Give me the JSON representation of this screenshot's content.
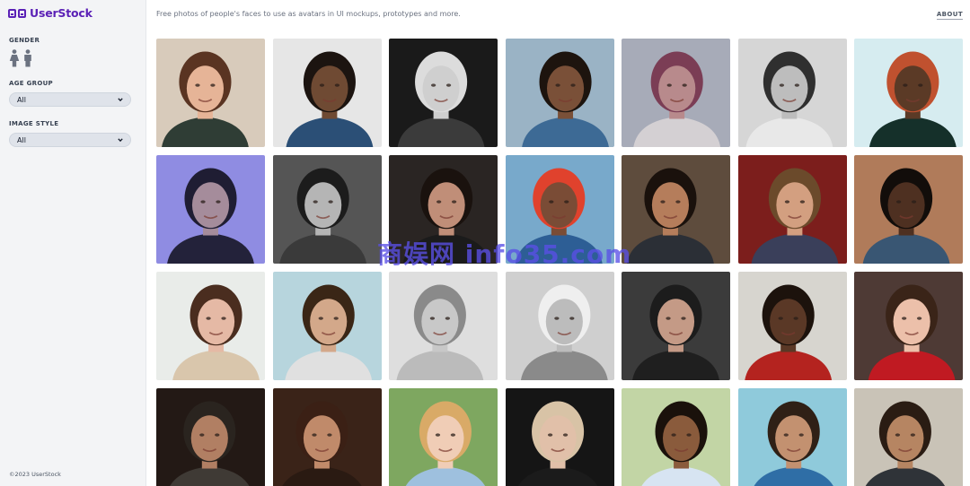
{
  "brand": {
    "name": "UserStock",
    "color": "#5b21b6"
  },
  "header": {
    "tagline": "Free photos of people's faces to use as avatars in UI mockups, prototypes and more.",
    "about_link": "ABOUT"
  },
  "sidebar": {
    "gender_label": "GENDER",
    "gender_icons": [
      "female-icon",
      "male-icon"
    ],
    "age_group_label": "AGE GROUP",
    "age_group_value": "All",
    "image_style_label": "IMAGE STYLE",
    "image_style_value": "All",
    "footer": "©2023 UserStock"
  },
  "watermark": "商娱网 info35.com",
  "photos": [
    {
      "bg": "#d8cbbb",
      "skin": "#e6b497",
      "hair": "#5a3422",
      "shirt": "#2f3d35"
    },
    {
      "bg": "#e6e6e6",
      "skin": "#6f4a33",
      "hair": "#1c1410",
      "shirt": "#2b4f76"
    },
    {
      "bg": "#1a1a1a",
      "skin": "#cfcfcf",
      "hair": "#dcdcdc",
      "shirt": "#3b3b3b"
    },
    {
      "bg": "#9ab3c5",
      "skin": "#7a5038",
      "hair": "#1d140e",
      "shirt": "#3d6a95"
    },
    {
      "bg": "#a7abb8",
      "skin": "#b88a8c",
      "hair": "#7b3d55",
      "shirt": "#d4d0d3"
    },
    {
      "bg": "#d6d6d6",
      "skin": "#bdbdbd",
      "hair": "#2f2f2f",
      "shirt": "#e8e8e8"
    },
    {
      "bg": "#d6ecf0",
      "skin": "#5b3a26",
      "hair": "#c0512f",
      "shirt": "#15302a"
    },
    {
      "bg": "#8f8ce2",
      "skin": "#a58c9b",
      "hair": "#1f1d33",
      "shirt": "#23223a"
    },
    {
      "bg": "#555555",
      "skin": "#b5b5b5",
      "hair": "#1c1c1c",
      "shirt": "#3a3a3a"
    },
    {
      "bg": "#2a2523",
      "skin": "#c08e78",
      "hair": "#1a120e",
      "shirt": "#1b1b1b"
    },
    {
      "bg": "#78a9cb",
      "skin": "#7a4c36",
      "hair": "#e0422d",
      "shirt": "#2d5e95"
    },
    {
      "bg": "#5e4c3d",
      "skin": "#b57d5b",
      "hair": "#1a110c",
      "shirt": "#2b2f36"
    },
    {
      "bg": "#7c1e1c",
      "skin": "#d39f80",
      "hair": "#6b4a2b",
      "shirt": "#3a3f5a"
    },
    {
      "bg": "#b07b5a",
      "skin": "#4e3021",
      "hair": "#120d0a",
      "shirt": "#395673"
    },
    {
      "bg": "#e9ece9",
      "skin": "#e5b9a5",
      "hair": "#4a2d1f",
      "shirt": "#d9c6ac"
    },
    {
      "bg": "#b7d5dd",
      "skin": "#d3a88a",
      "hair": "#3a2616",
      "shirt": "#e0e0e0"
    },
    {
      "bg": "#dedede",
      "skin": "#c8c8c8",
      "hair": "#8a8a8a",
      "shirt": "#bbbbbb"
    },
    {
      "bg": "#cfcfcf",
      "skin": "#bcbcbc",
      "hair": "#efefef",
      "shirt": "#8a8a8a"
    },
    {
      "bg": "#3b3b3b",
      "skin": "#c49a86",
      "hair": "#1c1c1c",
      "shirt": "#1f1f1f"
    },
    {
      "bg": "#d7d5cf",
      "skin": "#5a3826",
      "hair": "#1c120c",
      "shirt": "#b4231f"
    },
    {
      "bg": "#4e3a35",
      "skin": "#ecc0aa",
      "hair": "#3a2418",
      "shirt": "#c01a22"
    },
    {
      "bg": "#231915",
      "skin": "#b17f63",
      "hair": "#2a241f",
      "shirt": "#3f3a35"
    },
    {
      "bg": "#3a2318",
      "skin": "#c08a6a",
      "hair": "#3b2015",
      "shirt": "#2a1a12"
    },
    {
      "bg": "#7ea760",
      "skin": "#f0cdb6",
      "hair": "#d9aa67",
      "shirt": "#9ec0de"
    },
    {
      "bg": "#151515",
      "skin": "#e1c0a9",
      "hair": "#d8c3a6",
      "shirt": "#1b1b1b"
    },
    {
      "bg": "#c2d5a5",
      "skin": "#8a5b3c",
      "hair": "#1a110b",
      "shirt": "#d7e4f2"
    },
    {
      "bg": "#8fcadb",
      "skin": "#c39170",
      "hair": "#2f2016",
      "shirt": "#2f6ea6"
    },
    {
      "bg": "#c9c3b7",
      "skin": "#b68562",
      "hair": "#2a1c13",
      "shirt": "#2f3338"
    }
  ]
}
